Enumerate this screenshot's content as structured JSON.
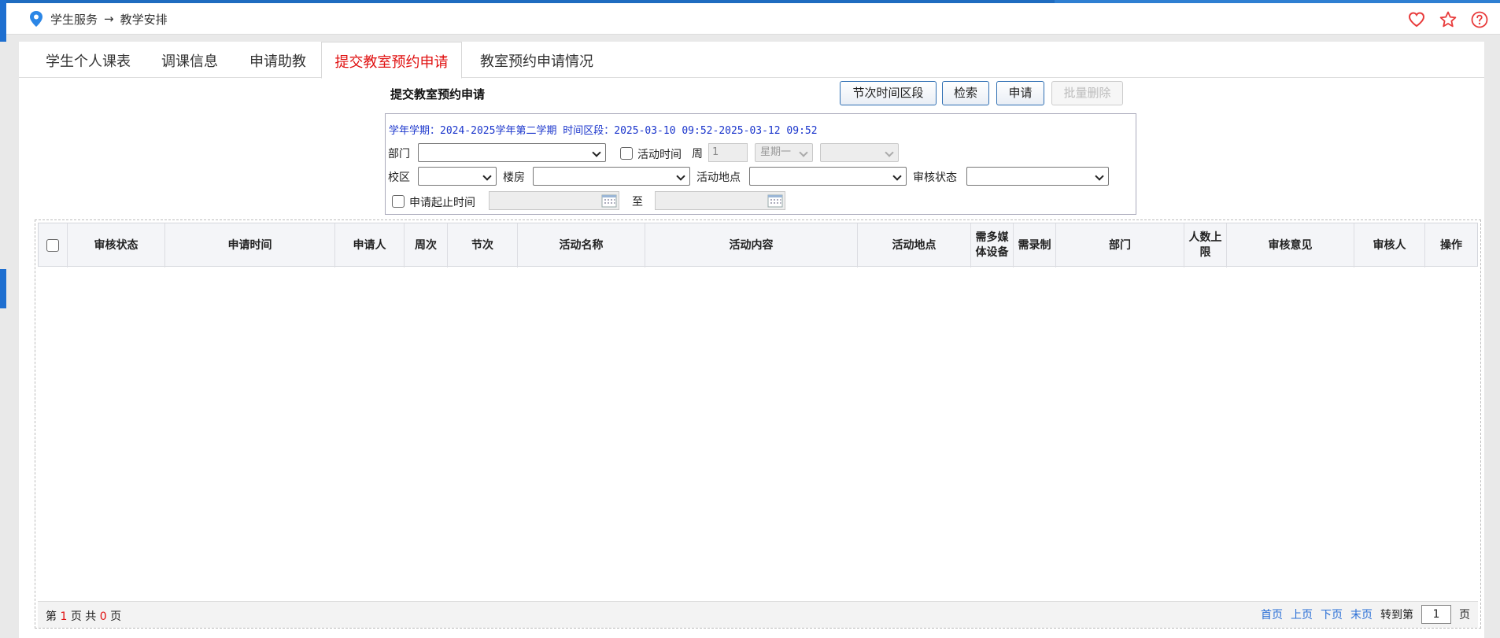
{
  "breadcrumb": {
    "section": "学生服务",
    "arrow": "→",
    "page": "教学安排"
  },
  "tabs": [
    {
      "label": "学生个人课表",
      "active": false
    },
    {
      "label": "调课信息",
      "active": false
    },
    {
      "label": "申请助教",
      "active": false
    },
    {
      "label": "提交教室预约申请",
      "active": true
    },
    {
      "label": "教室预约申请情况",
      "active": false
    }
  ],
  "form": {
    "title": "提交教室预约申请",
    "buttons": {
      "time_section": "节次时间区段",
      "search": "检索",
      "apply": "申请",
      "batch_delete": "批量删除"
    }
  },
  "query": {
    "info": "学年学期：2024-2025学年第二学期 时间区段：2025-03-10 09:52-2025-03-12 09:52",
    "department_label": "部门",
    "activity_time_label": "活动时间",
    "week_label": "周",
    "week_value": "1",
    "weekday_value": "星期一",
    "campus_label": "校区",
    "building_label": "楼房",
    "location_label": "活动地点",
    "status_label": "审核状态",
    "date_range_label": "申请起止时间",
    "to_label": "至"
  },
  "table": {
    "columns": [
      "审核状态",
      "申请时间",
      "申请人",
      "周次",
      "节次",
      "活动名称",
      "活动内容",
      "活动地点",
      "需多媒体设备",
      "需录制",
      "部门",
      "人数上限",
      "审核意见",
      "审核人",
      "操作"
    ],
    "rows": []
  },
  "pagination": {
    "page_prefix": "第",
    "current_page": "1",
    "page_mid": "页  共",
    "total_pages": "0",
    "page_suffix": "页",
    "first": "首页",
    "prev": "上页",
    "next": "下页",
    "last": "末页",
    "goto_label": "转到第",
    "goto_value": "1",
    "goto_suffix": "页"
  },
  "colors": {
    "accent": "#1e6fd0",
    "active_tab": "#e01010",
    "info_text": "#1a35cc",
    "link": "#2a6fd6"
  }
}
